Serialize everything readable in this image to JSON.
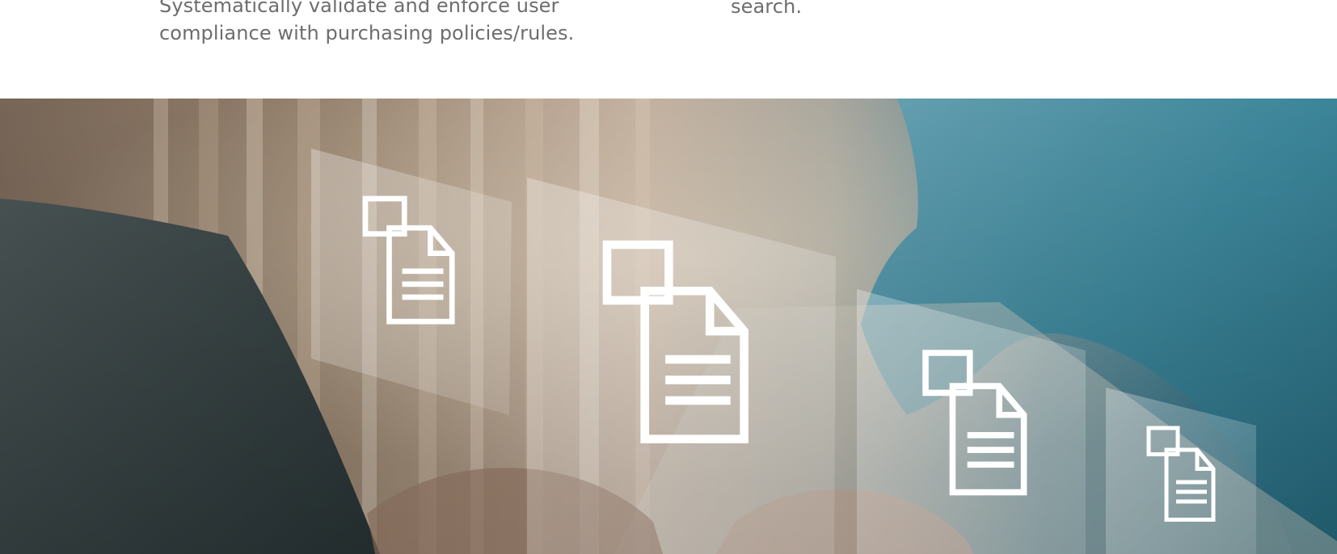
{
  "features": {
    "left_text": "Systematically validate and enforce user compliance with purchasing policies/rules.",
    "right_text": "search."
  },
  "hero": {
    "image_icon": "documents-icon",
    "tile_count_shown": 4
  }
}
